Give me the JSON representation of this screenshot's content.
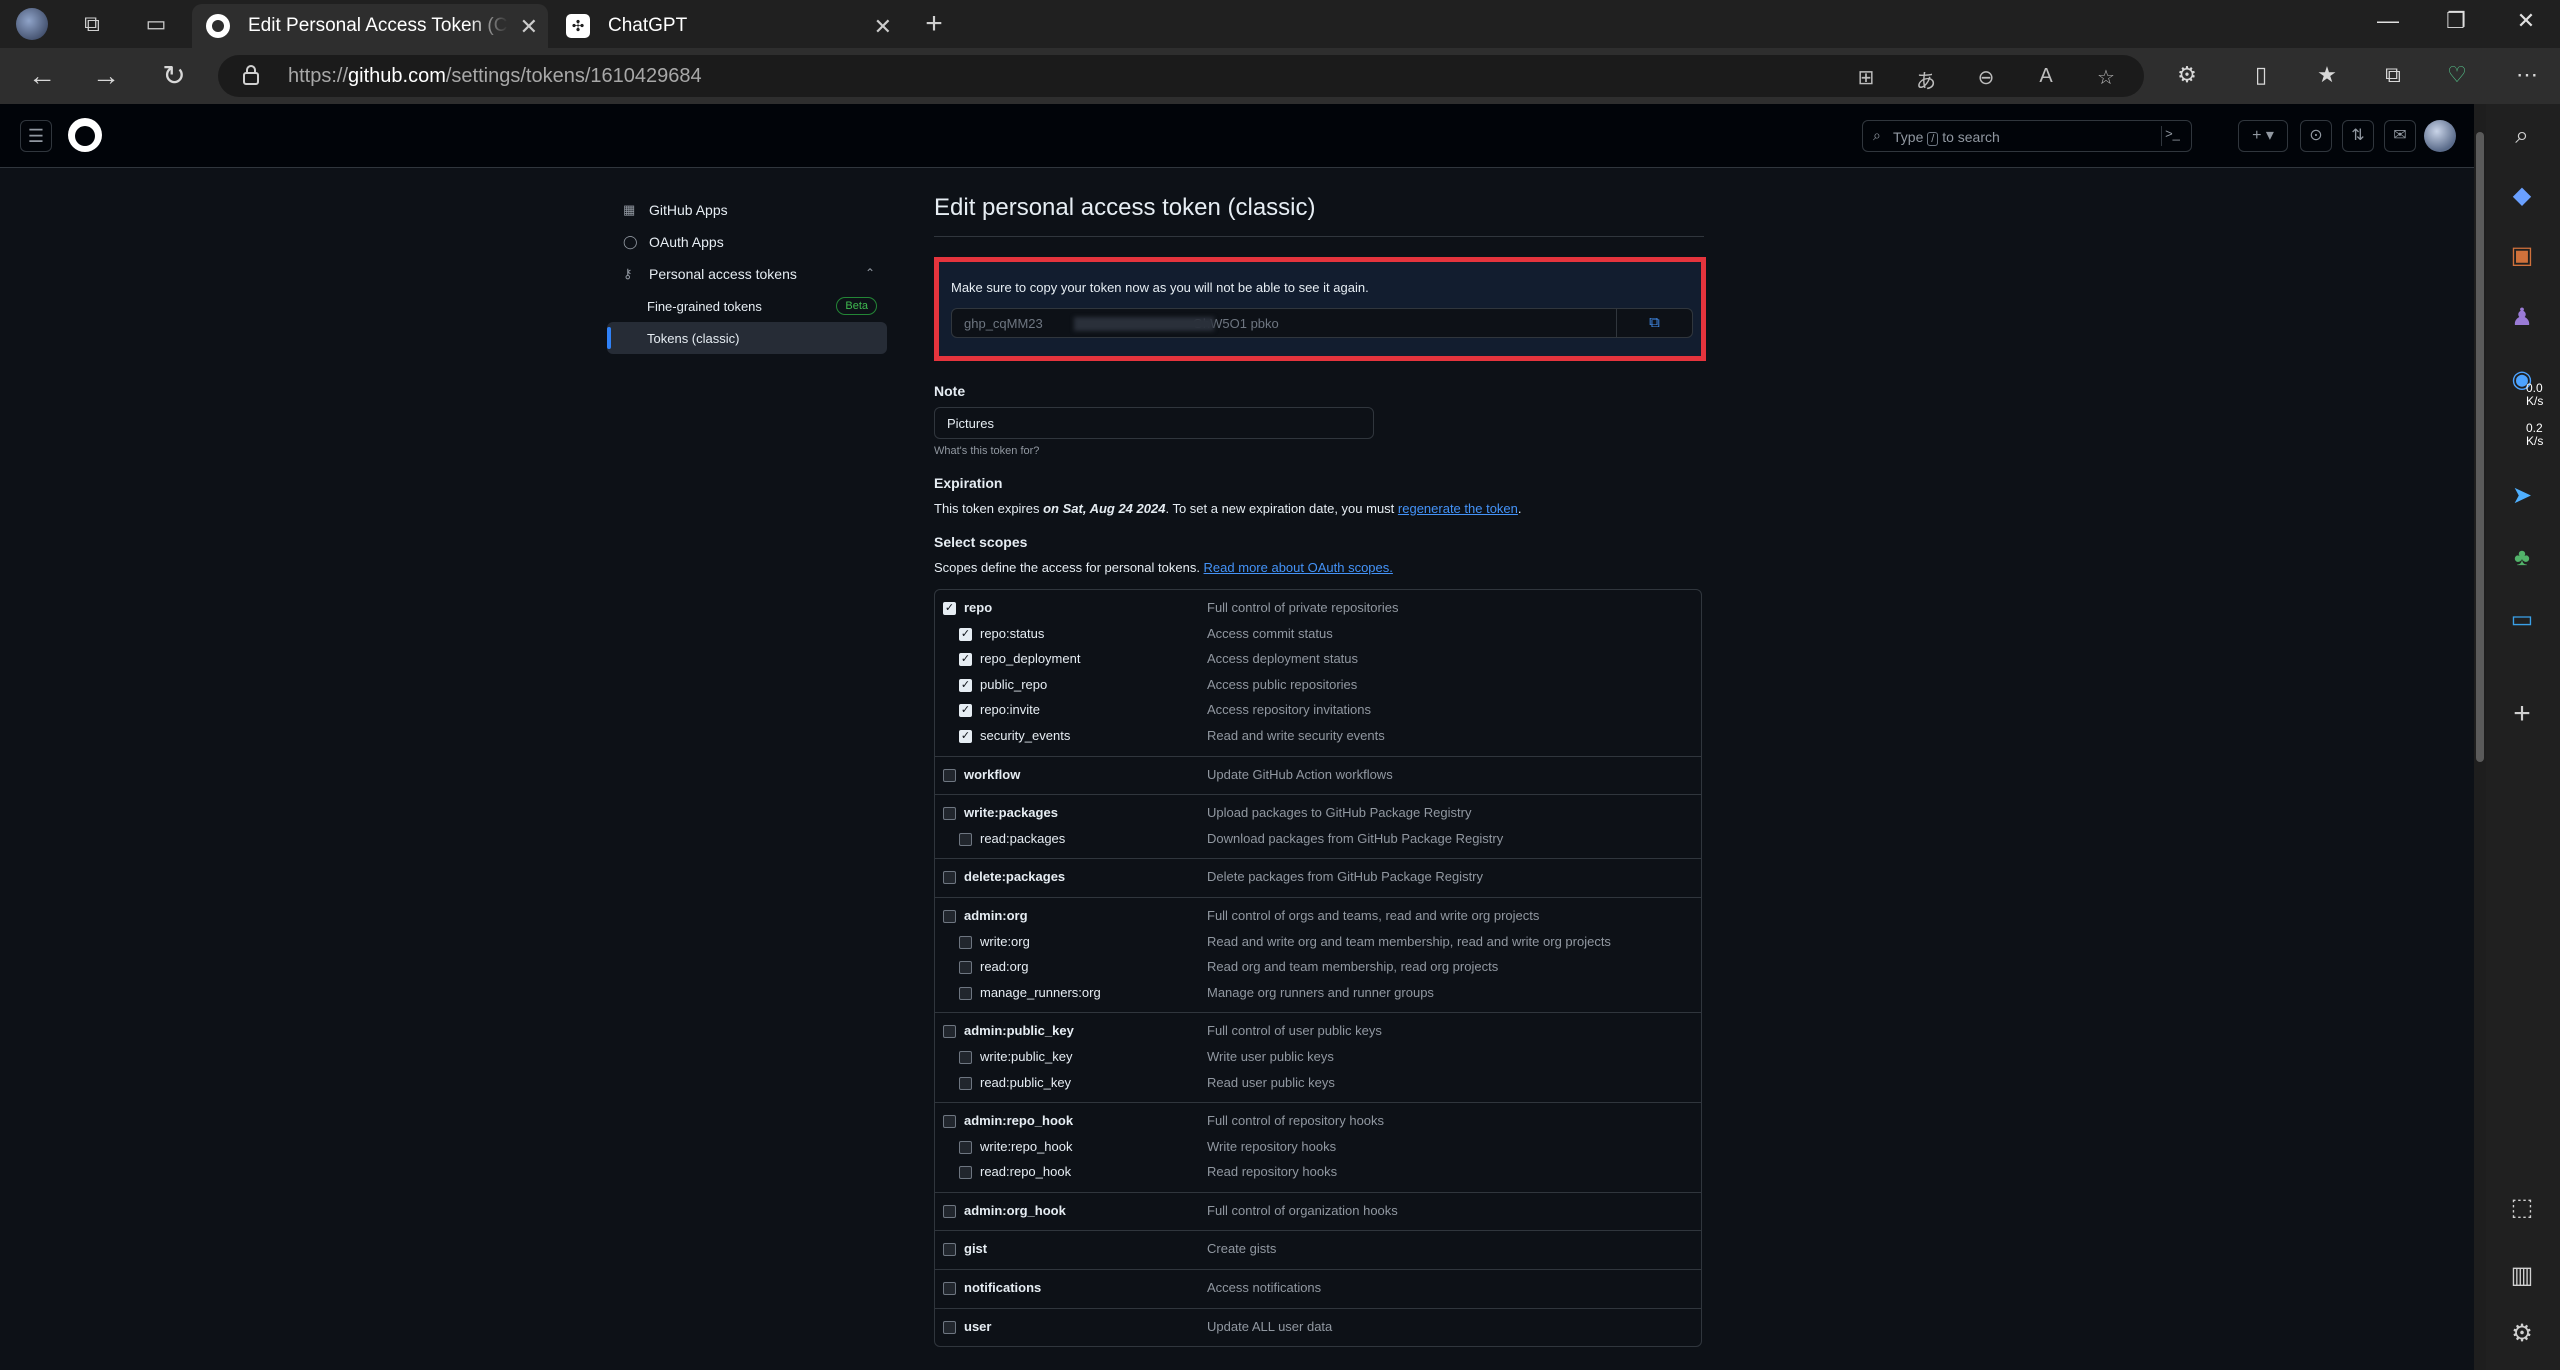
{
  "browser": {
    "tabs": [
      {
        "title": "Edit Personal Access Token (Classic)",
        "active": true,
        "favicon": "github-icon"
      },
      {
        "title": "ChatGPT",
        "active": false,
        "favicon": "chatgpt-icon"
      }
    ],
    "url_prefix": "https://",
    "url_domain": "github.com",
    "url_path": "/settings/tokens/1610429684"
  },
  "github_header": {
    "search_placeholder_pre": "Type",
    "search_key": "/",
    "search_placeholder_post": "to search",
    "new_button": "+ ▾"
  },
  "sidebar": {
    "items": [
      {
        "label": "GitHub Apps",
        "icon": "apps-grid-icon"
      },
      {
        "label": "OAuth Apps",
        "icon": "person-icon"
      },
      {
        "label": "Personal access tokens",
        "icon": "key-icon"
      },
      {
        "label": "Fine-grained tokens",
        "badge": "Beta"
      },
      {
        "label": "Tokens (classic)",
        "selected": true
      }
    ]
  },
  "main": {
    "title": "Edit personal access token (classic)",
    "flash_message": "Make sure to copy your token now as you will not be able to see it again.",
    "token_prefix": "ghp_cqMM23",
    "token_suffix": "GhW5O1 pbko",
    "note_label": "Note",
    "note_value": "Pictures",
    "note_hint": "What's this token for?",
    "expiration_label": "Expiration",
    "expiration_pre": "This token expires ",
    "expiration_date": "on Sat, Aug 24 2024",
    "expiration_mid": ". To set a new expiration date, you must ",
    "expiration_link": "regenerate the token",
    "expiration_end": ".",
    "scopes_label": "Select scopes",
    "scopes_desc": "Scopes define the access for personal tokens. ",
    "scopes_link": "Read more about OAuth scopes."
  },
  "scope_groups": [
    {
      "name": "repo",
      "desc": "Full control of private repositories",
      "checked": true,
      "children": [
        {
          "name": "repo:status",
          "desc": "Access commit status",
          "checked": true
        },
        {
          "name": "repo_deployment",
          "desc": "Access deployment status",
          "checked": true
        },
        {
          "name": "public_repo",
          "desc": "Access public repositories",
          "checked": true
        },
        {
          "name": "repo:invite",
          "desc": "Access repository invitations",
          "checked": true
        },
        {
          "name": "security_events",
          "desc": "Read and write security events",
          "checked": true
        }
      ]
    },
    {
      "name": "workflow",
      "desc": "Update GitHub Action workflows",
      "checked": false,
      "children": []
    },
    {
      "name": "write:packages",
      "desc": "Upload packages to GitHub Package Registry",
      "checked": false,
      "children": [
        {
          "name": "read:packages",
          "desc": "Download packages from GitHub Package Registry",
          "checked": false
        }
      ]
    },
    {
      "name": "delete:packages",
      "desc": "Delete packages from GitHub Package Registry",
      "checked": false,
      "children": []
    },
    {
      "name": "admin:org",
      "desc": "Full control of orgs and teams, read and write org projects",
      "checked": false,
      "children": [
        {
          "name": "write:org",
          "desc": "Read and write org and team membership, read and write org projects",
          "checked": false
        },
        {
          "name": "read:org",
          "desc": "Read org and team membership, read org projects",
          "checked": false
        },
        {
          "name": "manage_runners:org",
          "desc": "Manage org runners and runner groups",
          "checked": false
        }
      ]
    },
    {
      "name": "admin:public_key",
      "desc": "Full control of user public keys",
      "checked": false,
      "children": [
        {
          "name": "write:public_key",
          "desc": "Write user public keys",
          "checked": false
        },
        {
          "name": "read:public_key",
          "desc": "Read user public keys",
          "checked": false
        }
      ]
    },
    {
      "name": "admin:repo_hook",
      "desc": "Full control of repository hooks",
      "checked": false,
      "children": [
        {
          "name": "write:repo_hook",
          "desc": "Write repository hooks",
          "checked": false
        },
        {
          "name": "read:repo_hook",
          "desc": "Read repository hooks",
          "checked": false
        }
      ]
    },
    {
      "name": "admin:org_hook",
      "desc": "Full control of organization hooks",
      "checked": false,
      "children": []
    },
    {
      "name": "gist",
      "desc": "Create gists",
      "checked": false,
      "children": []
    },
    {
      "name": "notifications",
      "desc": "Access notifications",
      "checked": false,
      "children": []
    },
    {
      "name": "user",
      "desc": "Update ALL user data",
      "checked": false,
      "children": []
    }
  ],
  "edge_sidebar": {
    "net_down": "0.0",
    "net_down_unit": "K/s",
    "net_up": "0.2",
    "net_up_unit": "K/s"
  },
  "colors": {
    "highlight": "#e5343d",
    "link": "#4493f8",
    "accent": "#2f81f7"
  }
}
